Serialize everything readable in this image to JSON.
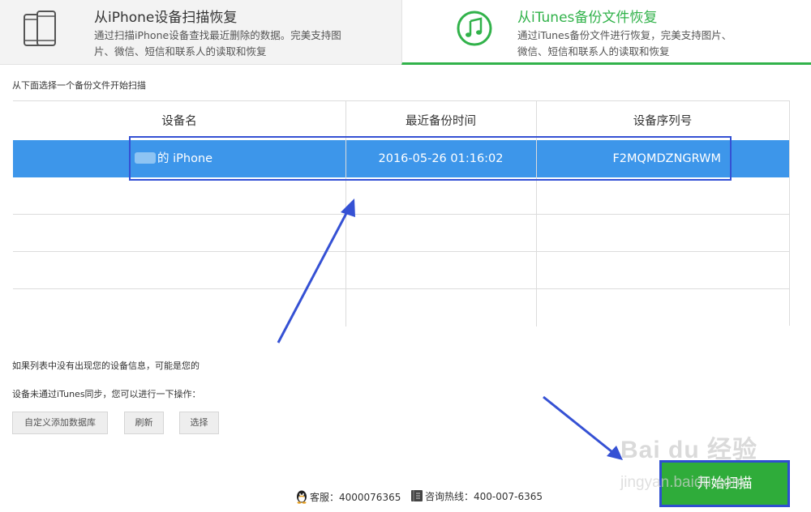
{
  "tabs": [
    {
      "title": "从iPhone设备扫描恢复",
      "description": "通过扫描iPhone设备查找最近删除的数据。完美支持图片、微信、短信和联系人的读取和恢复",
      "icon": "iphone-icon",
      "active": false
    },
    {
      "title": "从iTunes备份文件恢复",
      "description": "通过iTunes备份文件进行恢复，完美支持图片、微信、短信和联系人的读取和恢复",
      "icon": "music-note-icon",
      "active": true
    }
  ],
  "instruction": "从下面选择一个备份文件开始扫描",
  "table": {
    "headers": [
      "设备名",
      "最近备份时间",
      "设备序列号"
    ],
    "rows": [
      {
        "device_name": "的 iPhone",
        "backup_time": "2016-05-26   01:16:02",
        "serial": "F2MQMDZNGRWM",
        "selected": true
      }
    ],
    "empty_rows": 4
  },
  "notes": {
    "line1": "如果列表中没有出现您的设备信息，可能是您的",
    "line2": "设备未通过iTunes同步，您可以进行一下操作："
  },
  "buttons": {
    "custom_db": "自定义添加数据库",
    "refresh": "刷新",
    "select": "选择",
    "start_scan": "开始扫描"
  },
  "footer": {
    "qq_service": "客服：4000076365",
    "hotline": "咨询热线：400-007-6365"
  },
  "watermark": {
    "line1": "Bai du 经验",
    "line2": "jingyan.baidu.com"
  },
  "colors": {
    "accent_green": "#31b24a",
    "selected_row": "#3d96ea",
    "annotation_blue": "#3551d4"
  }
}
